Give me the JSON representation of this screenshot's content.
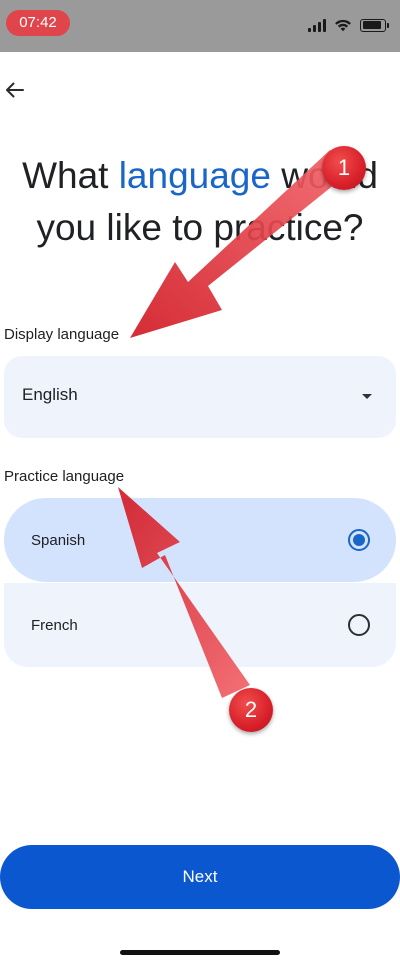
{
  "status_bar": {
    "time": "07:42",
    "signal_bars": 4,
    "battery_level": 0.9
  },
  "header": {
    "back_icon": "arrow-left-icon"
  },
  "title": {
    "part1": "What ",
    "accent": "language",
    "part2": " would you like to practice?",
    "accent_color": "#1a66c8"
  },
  "display_language": {
    "label": "Display language",
    "value": "English",
    "caret_icon": "caret-down-icon"
  },
  "practice_language": {
    "label": "Practice language",
    "options": [
      {
        "label": "Spanish",
        "selected": true
      },
      {
        "label": "French",
        "selected": false
      }
    ]
  },
  "next_button": {
    "label": "Next",
    "color": "#0b57d0"
  },
  "annotations": {
    "badge_1": "1",
    "badge_2": "2",
    "color": "#d8202a"
  }
}
